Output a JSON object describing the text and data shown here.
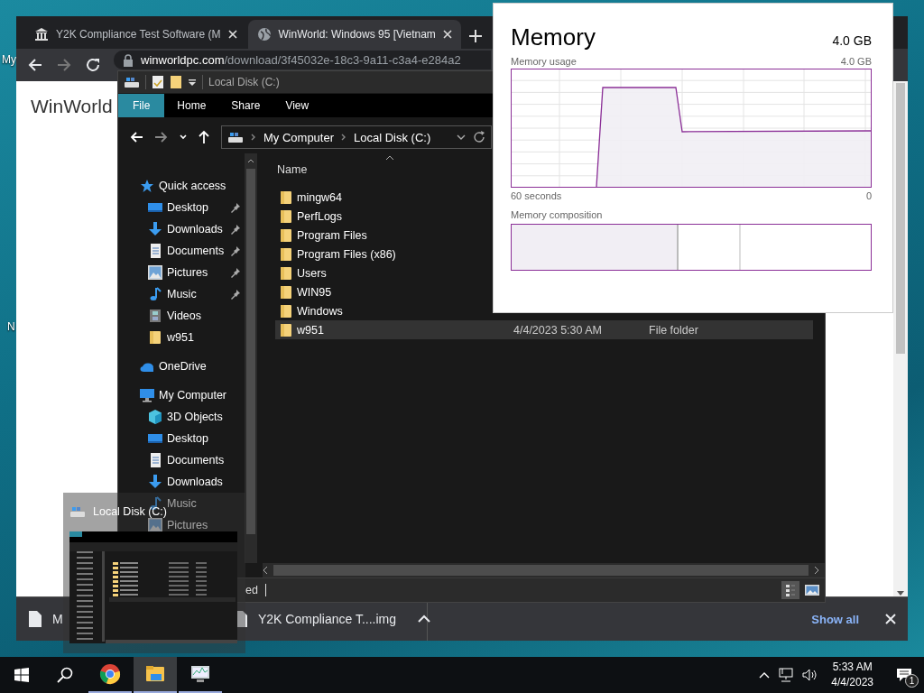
{
  "desktop": {
    "icon_labels": [
      "My",
      "N"
    ]
  },
  "browser": {
    "tabs": [
      {
        "title": "Y2K Compliance Test Software (M",
        "selected": false
      },
      {
        "title": "WinWorld: Windows 95 [Vietnam",
        "selected": true
      }
    ],
    "url_host": "winworldpc.com",
    "url_path": "/download/3f45032e-18c3-9a11-c3a4-e284a2",
    "page_heading": "WinWorld",
    "downloads": [
      {
        "name": "M"
      },
      {
        "name": "Y2K Compliance T....img"
      }
    ],
    "show_all": "Show all"
  },
  "explorer": {
    "title": "Local Disk (C:)",
    "ribbon_tabs": [
      {
        "label": "File",
        "selected": true
      },
      {
        "label": "Home",
        "selected": false
      },
      {
        "label": "Share",
        "selected": false
      },
      {
        "label": "View",
        "selected": false
      }
    ],
    "breadcrumb": [
      "My Computer",
      "Local Disk (C:)"
    ],
    "nav": [
      {
        "label": "Quick access",
        "kind": "star",
        "children": [
          {
            "label": "Desktop",
            "kind": "desktop",
            "pinned": true
          },
          {
            "label": "Downloads",
            "kind": "download",
            "pinned": true
          },
          {
            "label": "Documents",
            "kind": "document",
            "pinned": true
          },
          {
            "label": "Pictures",
            "kind": "picture",
            "pinned": true
          },
          {
            "label": "Music",
            "kind": "music",
            "pinned": true
          },
          {
            "label": "Videos",
            "kind": "video",
            "pinned": false
          },
          {
            "label": "w951",
            "kind": "folder",
            "pinned": false
          }
        ]
      },
      {
        "label": "OneDrive",
        "kind": "cloud"
      },
      {
        "label": "My Computer",
        "kind": "computer",
        "children": [
          {
            "label": "3D Objects",
            "kind": "cube"
          },
          {
            "label": "Desktop",
            "kind": "desktop"
          },
          {
            "label": "Documents",
            "kind": "document"
          },
          {
            "label": "Downloads",
            "kind": "download"
          },
          {
            "label": "Music",
            "kind": "music"
          },
          {
            "label": "Pictures",
            "kind": "picture"
          }
        ]
      }
    ],
    "column": "Name",
    "files": [
      {
        "name": "mingw64",
        "selected": false
      },
      {
        "name": "PerfLogs",
        "selected": false
      },
      {
        "name": "Program Files",
        "selected": false
      },
      {
        "name": "Program Files (x86)",
        "selected": false
      },
      {
        "name": "Users",
        "selected": false
      },
      {
        "name": "WIN95",
        "selected": false
      },
      {
        "name": "Windows",
        "selected": false
      },
      {
        "name": "w951",
        "selected": true,
        "date": "4/4/2023 5:30 AM",
        "type": "File folder"
      }
    ],
    "status": "ed"
  },
  "memory": {
    "title": "Memory",
    "total": "4.0 GB",
    "usage_label": "Memory usage",
    "usage_max": "4.0 GB",
    "time_start": "60 seconds",
    "time_end": "0",
    "composition_label": "Memory composition"
  },
  "preview": {
    "title": "Local Disk (C:)"
  },
  "taskbar": {
    "apps": [
      {
        "kind": "chrome",
        "selected": false
      },
      {
        "kind": "explorer",
        "selected": true
      },
      {
        "kind": "taskmgr",
        "selected": false
      }
    ],
    "time": "5:33 AM",
    "date": "4/4/2023",
    "notifications": "1"
  }
}
